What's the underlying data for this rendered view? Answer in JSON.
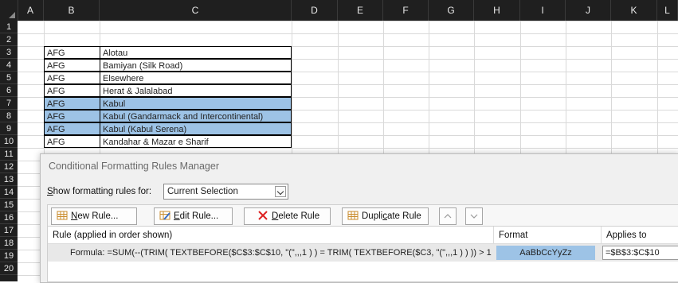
{
  "columns": [
    "A",
    "B",
    "C",
    "D",
    "E",
    "F",
    "G",
    "H",
    "I",
    "J",
    "K",
    "L"
  ],
  "rows": [
    "1",
    "2",
    "3",
    "4",
    "5",
    "6",
    "7",
    "8",
    "9",
    "10",
    "11",
    "12",
    "13",
    "14",
    "15",
    "16",
    "17",
    "18",
    "19",
    "20"
  ],
  "cells": [
    {
      "b": "AFG",
      "c": "Alotau"
    },
    {
      "b": "AFG",
      "c": "Bamiyan (Silk Road)"
    },
    {
      "b": "AFG",
      "c": "Elsewhere"
    },
    {
      "b": "AFG",
      "c": "Herat & Jalalabad"
    },
    {
      "b": "AFG",
      "c": "Kabul"
    },
    {
      "b": "AFG",
      "c": "Kabul (Gandarmack and Intercontinental)"
    },
    {
      "b": "AFG",
      "c": "Kabul (Kabul Serena)"
    },
    {
      "b": "AFG",
      "c": "Kandahar & Mazar e Sharif"
    }
  ],
  "highlight_color": "#9dc3e6",
  "dialog": {
    "title": "Conditional Formatting Rules Manager",
    "show_label_prefix": "S",
    "show_label_rest": "how formatting rules for:",
    "scope_value": "Current Selection",
    "buttons": {
      "new_rule_u": "N",
      "new_rule_rest": "ew Rule...",
      "edit_rule_u": "E",
      "edit_rule_rest": "dit Rule...",
      "delete_rule_u": "D",
      "delete_rule_rest": "elete Rule",
      "duplicate_rule_pre": "Dupli",
      "duplicate_rule_u": "c",
      "duplicate_rule_rest": "ate Rule"
    },
    "headers": {
      "rule": "Rule (applied in order shown)",
      "format": "Format",
      "applies_to": "Applies to"
    },
    "rule_row": {
      "rule_text": "Formula: =SUM(--(TRIM( TEXTBEFORE($C$3:$C$10, \"(\",,,1 ) ) = TRIM( TEXTBEFORE($C3, \"(\",,,1 ) ) )) > 1",
      "format_preview": "AaBbCcYyZz",
      "applies_to": "=$B$3:$C$10"
    }
  }
}
